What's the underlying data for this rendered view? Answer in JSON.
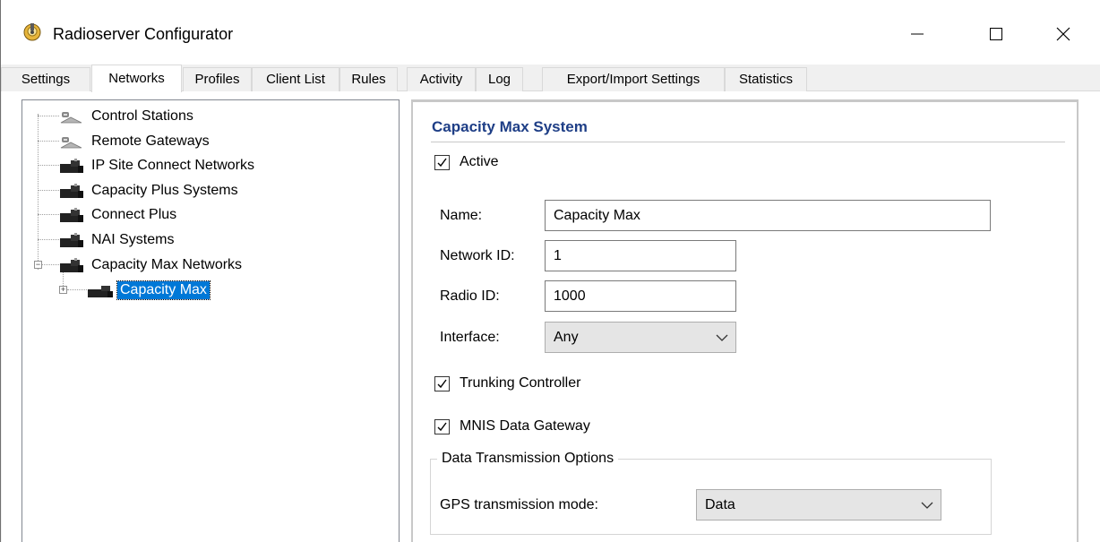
{
  "window": {
    "title": "Radioserver Configurator",
    "app_icon": "radioserver-app-icon",
    "controls": [
      "minimize-icon",
      "maximize-icon",
      "close-icon"
    ]
  },
  "tabs": [
    {
      "label": "Settings",
      "active": false
    },
    {
      "label": "Networks",
      "active": true
    },
    {
      "label": "Profiles",
      "active": false
    },
    {
      "label": "Client List",
      "active": false
    },
    {
      "label": "Rules",
      "active": false
    },
    {
      "label": "Activity",
      "active": false
    },
    {
      "label": "Log",
      "active": false
    },
    {
      "label": "Export/Import Settings",
      "active": false
    },
    {
      "label": "Statistics",
      "active": false
    }
  ],
  "tree": {
    "items": [
      {
        "label": "Control Stations",
        "icon": "control-station-icon"
      },
      {
        "label": "Remote Gateways",
        "icon": "remote-gateway-icon"
      },
      {
        "label": "IP Site Connect Networks",
        "icon": "network-icon"
      },
      {
        "label": "Capacity Plus Systems",
        "icon": "network-icon"
      },
      {
        "label": "Connect Plus",
        "icon": "network-icon"
      },
      {
        "label": "NAI Systems",
        "icon": "network-icon"
      },
      {
        "label": "Capacity Max Networks",
        "icon": "network-icon",
        "expanded": true
      },
      {
        "label": "Capacity Max",
        "icon": "system-icon",
        "selected": true,
        "collapsed": true
      }
    ]
  },
  "panel": {
    "title": "Capacity Max System",
    "active": {
      "label": "Active",
      "checked": true
    },
    "name": {
      "label": "Name:",
      "value": "Capacity Max"
    },
    "network_id": {
      "label": "Network ID:",
      "value": "1"
    },
    "radio_id": {
      "label": "Radio ID:",
      "value": "1000"
    },
    "interface": {
      "label": "Interface:",
      "value": "Any"
    },
    "trunking_controller": {
      "label": "Trunking Controller",
      "checked": true
    },
    "mnis_data_gateway": {
      "label": "MNIS Data Gateway",
      "checked": true
    },
    "data_transmission": {
      "legend": "Data Transmission Options",
      "gps_mode": {
        "label": "GPS transmission mode:",
        "value": "Data"
      }
    }
  },
  "colors": {
    "accent": "#0078d7",
    "panel_title": "#1e3e86"
  }
}
